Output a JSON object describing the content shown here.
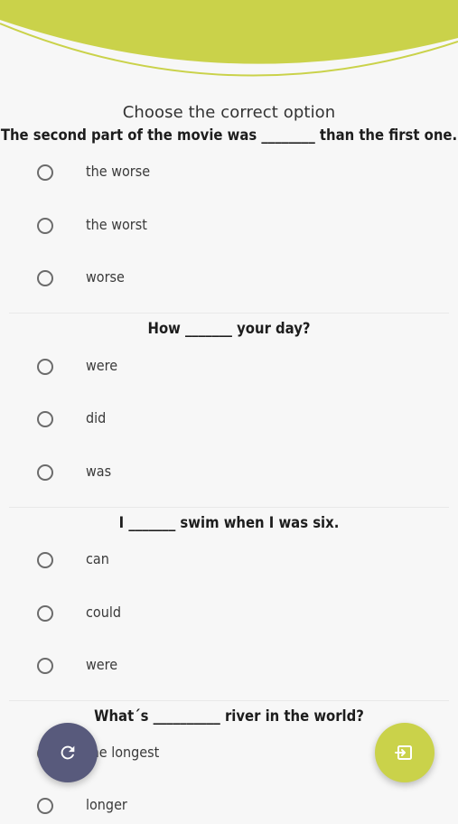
{
  "instruction": "Choose the correct option",
  "questions": [
    {
      "text": "The second part of the movie was ________ than the first one.",
      "options": [
        "the worse",
        "the worst",
        "worse"
      ]
    },
    {
      "text": "How _______ your day?",
      "options": [
        "were",
        "did",
        "was"
      ]
    },
    {
      "text": "I _______ swim when I was six.",
      "options": [
        "can",
        "could",
        "were"
      ]
    },
    {
      "text": "What´s __________ river in the world?",
      "options": [
        "the longest",
        "longer"
      ]
    }
  ],
  "fabs": {
    "left_icon": "refresh-icon",
    "right_icon": "exit-icon"
  },
  "colors": {
    "accent": "#cad24a",
    "fab_dark": "#585a7c",
    "radio_border": "#6b6b6b",
    "background": "#f7f7f7"
  }
}
